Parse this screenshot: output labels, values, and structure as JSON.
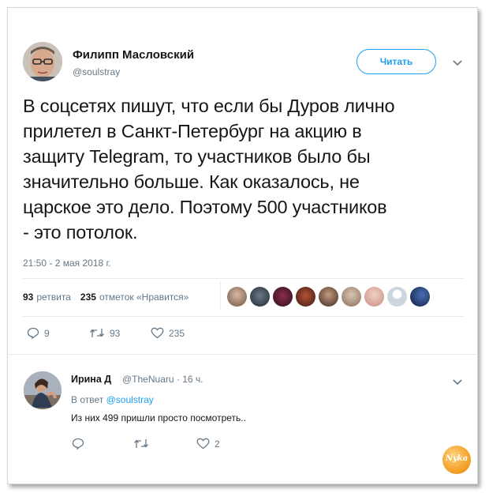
{
  "tweet": {
    "author_name": "Филипп Масловский",
    "author_handle": "@soulstray",
    "follow_label": "Читать",
    "text": "В соцсетях пишут, что если бы Дуров лично\nприлетел в Санкт-Петербург на акцию в\nзащиту Telegram, то участников было бы\nзначительно больше. Как оказалось, не\nцарское это дело. Поэтому 500 участников\n- это потолок.",
    "time": "21:50 - 2 мая 2018 г.",
    "retweets_count": "93",
    "retweets_label": "ретвита",
    "likes_count": "235",
    "likes_label": "отметок «Нравится»",
    "actions": {
      "replies": "9",
      "retweets": "93",
      "likes": "235"
    }
  },
  "reply": {
    "author_name": "Ирина Д",
    "author_handle": "@TheNuaru · 16 ч.",
    "in_reply_prefix": "В ответ",
    "in_reply_handle": "@soulstray",
    "text": "Из них 499 пришли просто посмотреть..",
    "actions": {
      "likes": "2"
    }
  },
  "watermark": {
    "text": "Nyka"
  },
  "colors": {
    "accent": "#1da1f2",
    "muted": "#657786",
    "text": "#14171a",
    "divider": "#e6ecf0"
  },
  "icons": [
    "chevron-down-icon",
    "reply-icon",
    "retweet-icon",
    "heart-icon"
  ]
}
